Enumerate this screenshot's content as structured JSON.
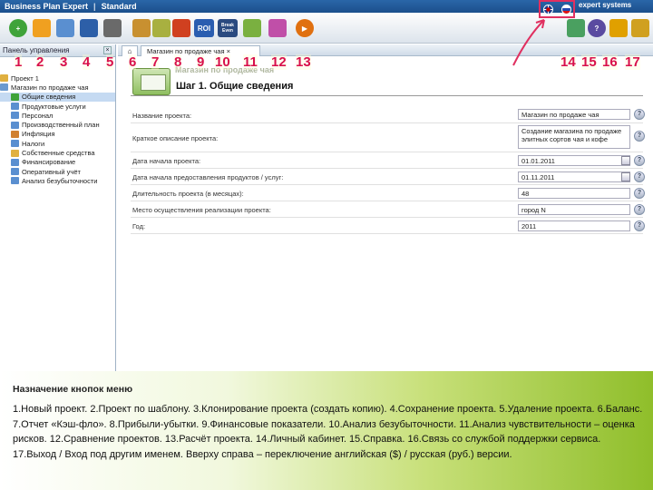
{
  "app": {
    "title_left": "Business Plan Expert",
    "separator": "|",
    "title_right": "Standard",
    "brand": "expert systems"
  },
  "language_icons": [
    "uk-flag-icon",
    "ru-flag-icon"
  ],
  "toolbar": {
    "buttons": [
      {
        "num": "1",
        "icon": "new-project-icon",
        "label": ""
      },
      {
        "num": "2",
        "icon": "template-icon",
        "label": ""
      },
      {
        "num": "3",
        "icon": "clone-icon",
        "label": ""
      },
      {
        "num": "4",
        "icon": "save-icon",
        "label": ""
      },
      {
        "num": "5",
        "icon": "delete-icon",
        "label": ""
      },
      {
        "num": "6",
        "icon": "balance-icon",
        "label": ""
      },
      {
        "num": "7",
        "icon": "cashflow-icon",
        "label": ""
      },
      {
        "num": "8",
        "icon": "profit-loss-icon",
        "label": ""
      },
      {
        "num": "9",
        "icon": "roi-icon",
        "label": "ROI"
      },
      {
        "num": "10",
        "icon": "break-even-icon",
        "label": "Break Even"
      },
      {
        "num": "11",
        "icon": "sensitivity-icon",
        "label": ""
      },
      {
        "num": "12",
        "icon": "compare-icon",
        "label": ""
      },
      {
        "num": "13",
        "icon": "calculate-icon",
        "label": ""
      },
      {
        "num": "14",
        "icon": "cabinet-icon",
        "label": ""
      },
      {
        "num": "15",
        "icon": "help-icon",
        "label": "?"
      },
      {
        "num": "16",
        "icon": "support-icon",
        "label": ""
      },
      {
        "num": "17",
        "icon": "exit-icon",
        "label": ""
      }
    ]
  },
  "left_panel": {
    "title": "Панель управления",
    "close": "×",
    "tree": [
      {
        "text": "Проект 1"
      },
      {
        "text": "Магазин по продаже чая"
      },
      {
        "text": "Общие сведения"
      },
      {
        "text": "Продуктовые услуги"
      },
      {
        "text": "Персонал"
      },
      {
        "text": "Производственный план"
      },
      {
        "text": "Инфляция"
      },
      {
        "text": "Налоги"
      },
      {
        "text": "Собственные средства"
      },
      {
        "text": "Финансирование"
      },
      {
        "text": "Оперативный учёт"
      },
      {
        "text": "Анализ безубыточности"
      }
    ]
  },
  "tabs": {
    "home": "⌂",
    "active": "Магазин по продаже чая  ×"
  },
  "form": {
    "project_name": "Магазин по продаже чая",
    "step_title": "Шаг 1. Общие сведения",
    "rows": [
      {
        "label": "Название проекта:",
        "value": "Магазин по продаже чая",
        "has_cal": false
      },
      {
        "label": "Краткое описание проекта:",
        "value": "Создание магазина по продаже элитных сортов чая и кофе",
        "has_cal": false
      },
      {
        "label": "Дата начала проекта:",
        "value": "01.01.2011",
        "has_cal": true
      },
      {
        "label": "Дата начала предоставления продуктов / услуг:",
        "value": "01.11.2011",
        "has_cal": true
      },
      {
        "label": "Длительность проекта (в месяцах):",
        "value": "48",
        "has_cal": false
      },
      {
        "label": "Место осуществления реализации проекта:",
        "value": "город N",
        "has_cal": false
      },
      {
        "label": "Год:",
        "value": "2011",
        "has_cal": false
      }
    ],
    "help_glyph": "?"
  },
  "caption": {
    "title": "Назначение кнопок меню",
    "text": "1.Новый проект. 2.Проект по шаблону. 3.Клонирование проекта (создать копию). 4.Сохранение проекта. 5.Удаление проекта. 6.Баланс. 7.Отчет «Кэш-фло». 8.Прибыли-убытки. 9.Финансовые показатели. 10.Анализ безубыточности. 11.Анализ чувствительности – оценка рисков. 12.Сравнение проектов. 13.Расчёт проекта. 14.Личный кабинет. 15.Справка. 16.Связь со службой поддержки сервиса. 17.Выход / Вход под другим именем.  Вверху справа – переключение английская ($) / русская (руб.) версии."
  },
  "colors": {
    "accent_red": "#d8104c",
    "title_blue": "#1b4f8c",
    "caption_green": "#8fbe2a"
  }
}
